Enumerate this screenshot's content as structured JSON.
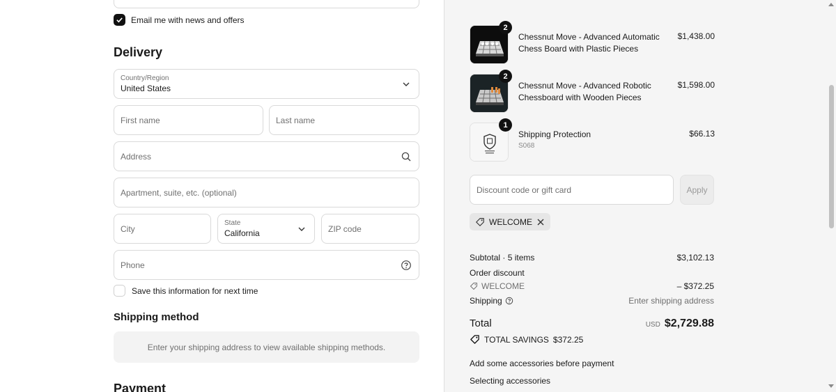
{
  "contact": {
    "newsletter_label": "Email me with news and offers",
    "newsletter_checked": true
  },
  "delivery": {
    "heading": "Delivery",
    "country": {
      "label": "Country/Region",
      "value": "United States"
    },
    "first_name_placeholder": "First name",
    "last_name_placeholder": "Last name",
    "address_placeholder": "Address",
    "apartment_placeholder": "Apartment, suite, etc. (optional)",
    "city_placeholder": "City",
    "state": {
      "label": "State",
      "value": "California"
    },
    "zip_placeholder": "ZIP code",
    "phone_placeholder": "Phone",
    "save_info_label": "Save this information for next time"
  },
  "shipping_method": {
    "heading": "Shipping method",
    "message": "Enter your shipping address to view available shipping methods."
  },
  "payment": {
    "heading": "Payment"
  },
  "order": {
    "items": [
      {
        "name": "Chessnut Move - Advanced Automatic Chess Board with Plastic Pieces",
        "price": "$1,438.00",
        "quantity": "2",
        "subtitle": ""
      },
      {
        "name": "Chessnut Move - Advanced Robotic Chessboard with Wooden Pieces",
        "price": "$1,598.00",
        "quantity": "2",
        "subtitle": ""
      },
      {
        "name": "Shipping Protection",
        "price": "$66.13",
        "quantity": "1",
        "subtitle": "S068"
      }
    ],
    "discount_placeholder": "Discount code or gift card",
    "apply_label": "Apply",
    "applied_code": "WELCOME",
    "subtotal_label": "Subtotal · 5 items",
    "subtotal_value": "$3,102.13",
    "order_discount_label": "Order discount",
    "order_discount_code": "WELCOME",
    "order_discount_value": "– $372.25",
    "shipping_label": "Shipping",
    "shipping_value": "Enter shipping address",
    "total_label": "Total",
    "total_currency": "USD",
    "total_value": "$2,729.88",
    "savings_label": "TOTAL SAVINGS",
    "savings_value": "$372.25",
    "accessories_label": "Add some accessories before payment",
    "selecting_label": "Selecting accessories"
  },
  "colors": {
    "accent": "#111111",
    "panel": "#f5f5f5",
    "border": "#d9d9d9"
  }
}
